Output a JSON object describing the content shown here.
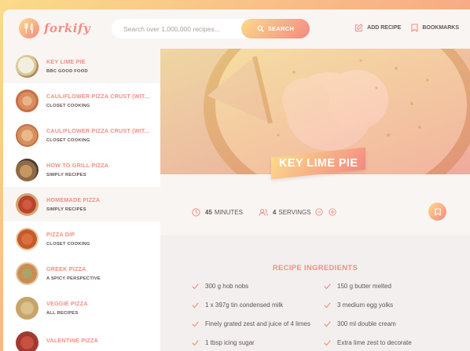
{
  "header": {
    "logo_text": "forkify",
    "search_placeholder": "Search over 1,000,000 recipes...",
    "search_button": "SEARCH",
    "add_recipe": "ADD RECIPE",
    "bookmarks": "BOOKMARKS"
  },
  "results": [
    {
      "title": "KEY LIME PIE",
      "publisher": "BBC GOOD FOOD",
      "active": true,
      "thumb": "key-lime-pie"
    },
    {
      "title": "CAULIFLOWER PIZZA CRUST (WIT...",
      "publisher": "CLOSET COOKING",
      "active": false,
      "thumb": "pizza"
    },
    {
      "title": "CAULIFLOWER PIZZA CRUST (WIT...",
      "publisher": "CLOSET COOKING",
      "active": false,
      "thumb": "pizza"
    },
    {
      "title": "HOW TO GRILL PIZZA",
      "publisher": "SIMPLY RECIPES",
      "active": false,
      "thumb": "grill"
    },
    {
      "title": "HOMEMADE PIZZA",
      "publisher": "SIMPLY RECIPES",
      "active": true,
      "thumb": "pizza2"
    },
    {
      "title": "PIZZA DIP",
      "publisher": "CLOSET COOKING",
      "active": false,
      "thumb": "dip"
    },
    {
      "title": "GREEK PIZZA",
      "publisher": "A SPICY PERSPECTIVE",
      "active": false,
      "thumb": "greek"
    },
    {
      "title": "VEGGIE PIZZA",
      "publisher": "ALL RECIPES",
      "active": false,
      "thumb": "veggie"
    },
    {
      "title": "VALENTINE PIZZA",
      "publisher": "",
      "active": false,
      "thumb": "valentine"
    }
  ],
  "recipe": {
    "title": "KEY LIME PIE",
    "minutes_value": "45",
    "minutes_label": "MINUTES",
    "servings_value": "4",
    "servings_label": "SERVINGS",
    "ingredients_heading": "RECIPE INGREDIENTS",
    "ingredients": [
      "300 g hob nobs",
      "150 g butter melted",
      "1 x 397g tin condensed milk",
      "3 medium egg yolks",
      "Finely grated zest and juice of 4 limes",
      "300 ml double cream",
      "1 tbsp icing sugar",
      "Extra lime zest to decorate"
    ]
  },
  "colors": {
    "accent": "#f38e82",
    "gradient_start": "#fbdb89",
    "gradient_end": "#f48982",
    "text": "#615551",
    "light_bg": "#f9f5f3"
  }
}
